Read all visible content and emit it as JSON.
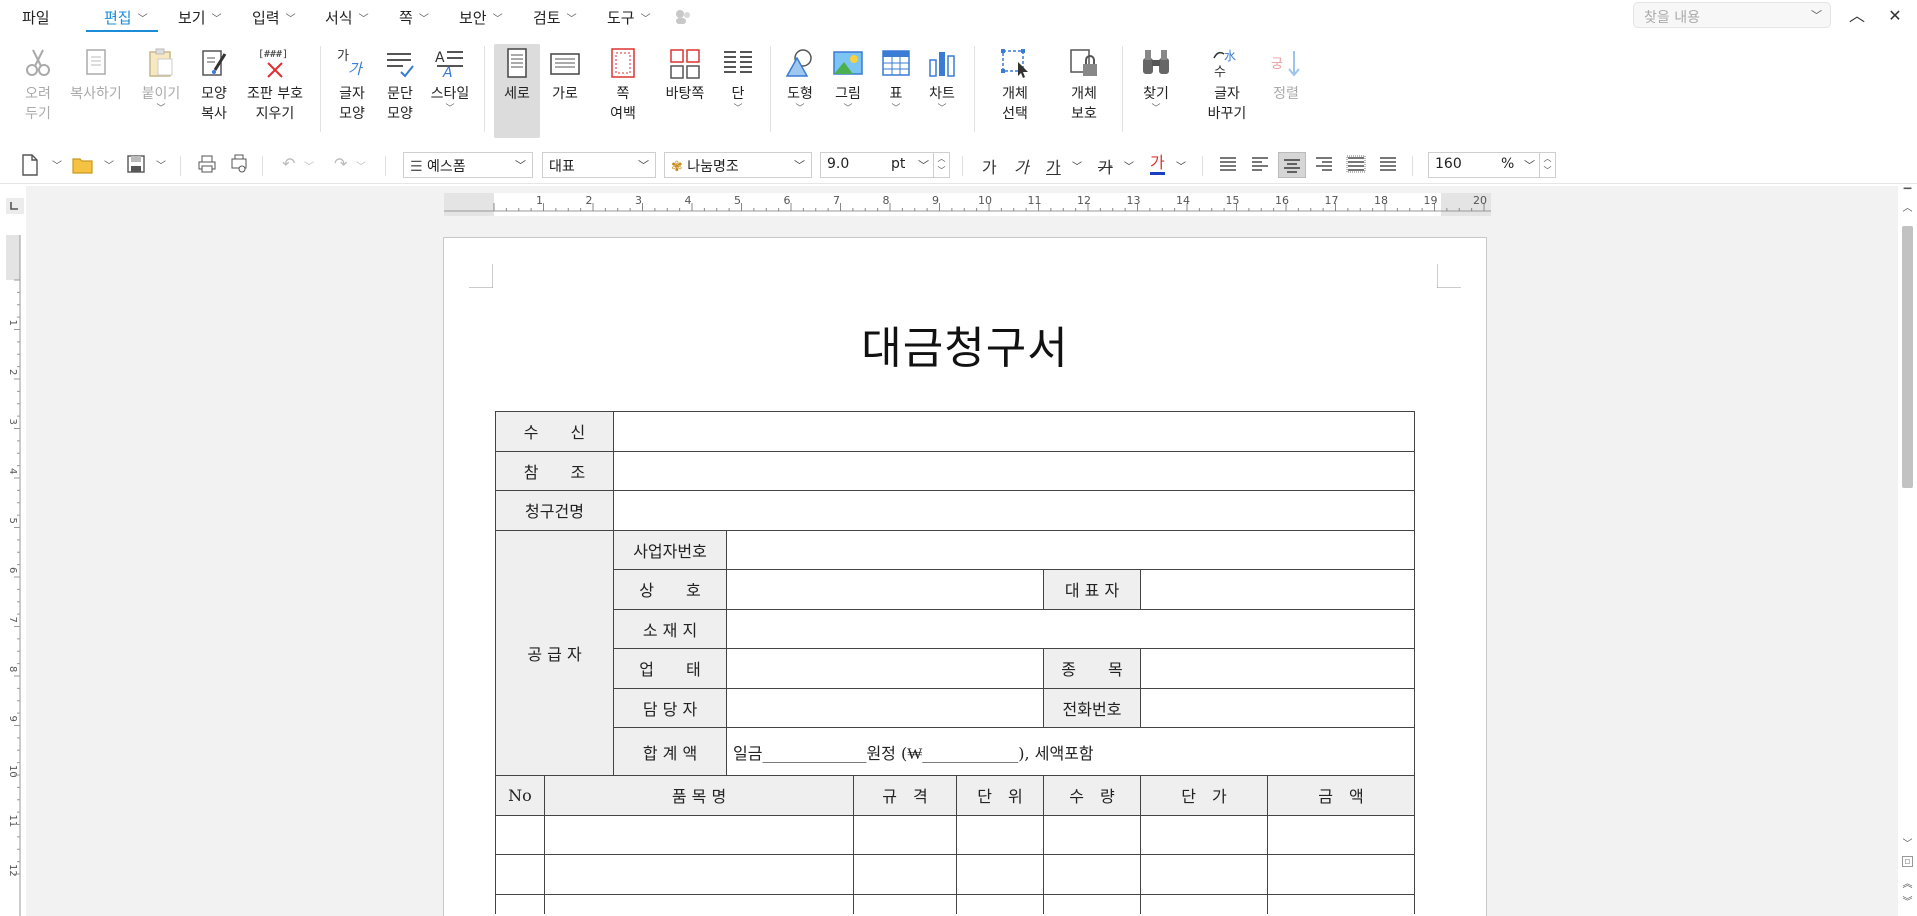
{
  "menubar": {
    "file": "파일",
    "tabs": [
      {
        "label": "편집"
      },
      {
        "label": "보기"
      },
      {
        "label": "입력"
      },
      {
        "label": "서식"
      },
      {
        "label": "쪽"
      },
      {
        "label": "보안"
      },
      {
        "label": "검토"
      },
      {
        "label": "도구"
      }
    ],
    "search_placeholder": "찾을 내용"
  },
  "ribbon": {
    "cut": [
      "오려",
      "두기"
    ],
    "copy": "복사하기",
    "paste": "붙이기",
    "format_copy": [
      "모양",
      "복사"
    ],
    "clear_format": [
      "조판 부호",
      "지우기"
    ],
    "clear_format_icon": "[###]",
    "char_shape": [
      "글자",
      "모양"
    ],
    "para_shape": [
      "문단",
      "모양"
    ],
    "style": "스타일",
    "portrait": "세로",
    "landscape": "가로",
    "margin": [
      "쪽",
      "여백"
    ],
    "background": "바탕쪽",
    "column": "단",
    "shape": "도형",
    "picture": "그림",
    "table": "표",
    "chart": "차트",
    "obj_select": [
      "개체",
      "선택"
    ],
    "obj_protect": [
      "개체",
      "보호"
    ],
    "find": "찾기",
    "replace": [
      "글자",
      "바꾸기"
    ],
    "sort": "정렬"
  },
  "toolbar": {
    "style_name": "예스폼",
    "para_style": "대표",
    "font_name": "나눔명조",
    "font_size": "9.0",
    "font_unit": "pt",
    "zoom": "160",
    "zoom_unit": "%",
    "bold": "가",
    "italic": "가",
    "underline": "가",
    "strike": "가",
    "color": "가"
  },
  "ruler": {
    "h_ticks": [
      "1",
      "2",
      "3",
      "4",
      "5",
      "6",
      "7",
      "8",
      "9",
      "10",
      "11",
      "12",
      "13",
      "14",
      "15",
      "16",
      "17",
      "18",
      "19",
      "20"
    ],
    "v_ticks": [
      "1",
      "2",
      "3",
      "4",
      "5",
      "6",
      "7",
      "8",
      "9",
      "10",
      "11",
      "12"
    ]
  },
  "document": {
    "title": "대금청구서",
    "recipient": "수　　신",
    "reference": "참　　조",
    "billing_name": "청구건명",
    "supplier": "공 급 자",
    "biz_no": "사업자번호",
    "company": "상　　호",
    "ceo": "대 표 자",
    "address": "소 재 지",
    "business": "업　　태",
    "item_type": "종　　목",
    "manager": "담 당 자",
    "phone": "전화번호",
    "total": "합 계 액",
    "total_value": "일금_____________원정 (₩____________), 세액포함",
    "col_no": "No",
    "col_item": "품 목 명",
    "col_spec": "규　격",
    "col_unit": "단　위",
    "col_qty": "수　량",
    "col_price": "단　가",
    "col_amount": "금　액"
  }
}
